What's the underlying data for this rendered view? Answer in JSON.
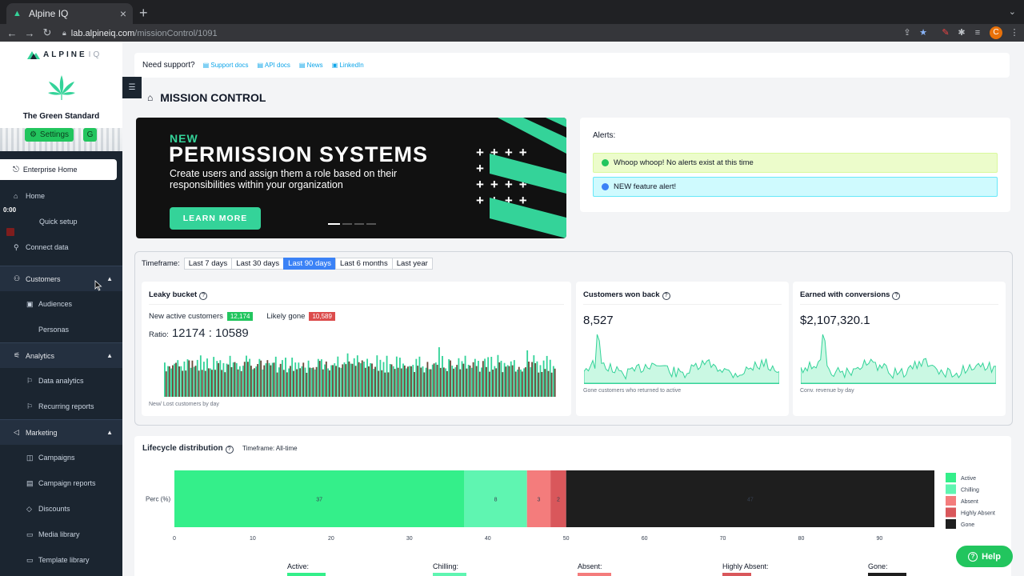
{
  "browser": {
    "tab_title": "Alpine IQ",
    "url_host": "lab.alpineiq.com",
    "url_path": "/missionControl/1091",
    "profile_initial": "C"
  },
  "sidebar": {
    "logo_text": "ALPINE",
    "logo_suffix": "IQ",
    "store_name": "The Green Standard",
    "settings_label": "Settings",
    "g_label": "G",
    "enterprise_home": "Enterprise Home",
    "timer": "0:00",
    "items": [
      {
        "label": "Home",
        "icon": "home-icon"
      },
      {
        "label": "Quick setup",
        "icon": "rocket-icon"
      },
      {
        "label": "Connect data",
        "icon": "plug-icon"
      }
    ],
    "groups": [
      {
        "label": "Customers",
        "icon": "users-icon",
        "children": [
          "Audiences",
          "Personas"
        ]
      },
      {
        "label": "Analytics",
        "icon": "analytics-icon",
        "children": [
          "Data analytics",
          "Recurring reports"
        ]
      },
      {
        "label": "Marketing",
        "icon": "megaphone-icon",
        "children": [
          "Campaigns",
          "Campaign reports",
          "Discounts",
          "Media library",
          "Template library"
        ]
      }
    ]
  },
  "support": {
    "label": "Need support?",
    "links": [
      "Support docs",
      "API docs",
      "News",
      "LinkedIn"
    ]
  },
  "page_title": "MISSION CONTROL",
  "banner": {
    "kicker": "NEW",
    "headline": "PERMISSION SYSTEMS",
    "subtext": "Create users and assign them a role based on their responsibilities within your organization",
    "cta": "LEARN MORE",
    "colors": {
      "accent": "#34d399",
      "background": "#111111"
    }
  },
  "alerts": {
    "title": "Alerts:",
    "items": [
      {
        "text": "Whoop whoop! No alerts exist at this time",
        "type": "success"
      },
      {
        "text": "NEW feature alert!",
        "type": "info"
      }
    ]
  },
  "timeframe": {
    "label": "Timeframe:",
    "options": [
      "Last 7 days",
      "Last 30 days",
      "Last 90 days",
      "Last 6 months",
      "Last year"
    ],
    "selected": "Last 90 days"
  },
  "leaky": {
    "title": "Leaky bucket",
    "new_label": "New active customers",
    "new_value": "12,174",
    "gone_label": "Likely gone",
    "gone_value": "10,589",
    "ratio_label": "Ratio:",
    "ratio_value": "12174 : 10589",
    "footer": "New/ Lost customers by day"
  },
  "won_back": {
    "title": "Customers won back",
    "value": "8,527",
    "footer": "Gone customers who returned to active"
  },
  "conversions": {
    "title": "Earned with conversions",
    "value": "$2,107,320.1",
    "footer": "Conv. revenue by day"
  },
  "lifecycle": {
    "title": "Lifecycle distribution",
    "timeframe": "Timeframe: All-time",
    "bottom_labels": [
      "Active:",
      "Chilling:",
      "Absent:",
      "Highly Absent:",
      "Gone:"
    ]
  },
  "chart_data": {
    "type": "bar",
    "title": "",
    "orientation": "horizontal-stacked",
    "categories": [
      "Perc (%)"
    ],
    "series": [
      {
        "name": "Active",
        "values": [
          37
        ],
        "color": "#34ef8a"
      },
      {
        "name": "Chilling",
        "values": [
          8
        ],
        "color": "#5ff5b1"
      },
      {
        "name": "Absent",
        "values": [
          3
        ],
        "color": "#f47c7c"
      },
      {
        "name": "Highly Absent",
        "values": [
          2
        ],
        "color": "#d9575b"
      },
      {
        "name": "Gone",
        "values": [
          47
        ],
        "color": "#1e1e1e"
      }
    ],
    "xticks": [
      "0",
      "10",
      "20",
      "30",
      "40",
      "50",
      "60",
      "70",
      "80",
      "90"
    ],
    "xlim": [
      0,
      97
    ],
    "legend": "right"
  },
  "help_label": "Help"
}
